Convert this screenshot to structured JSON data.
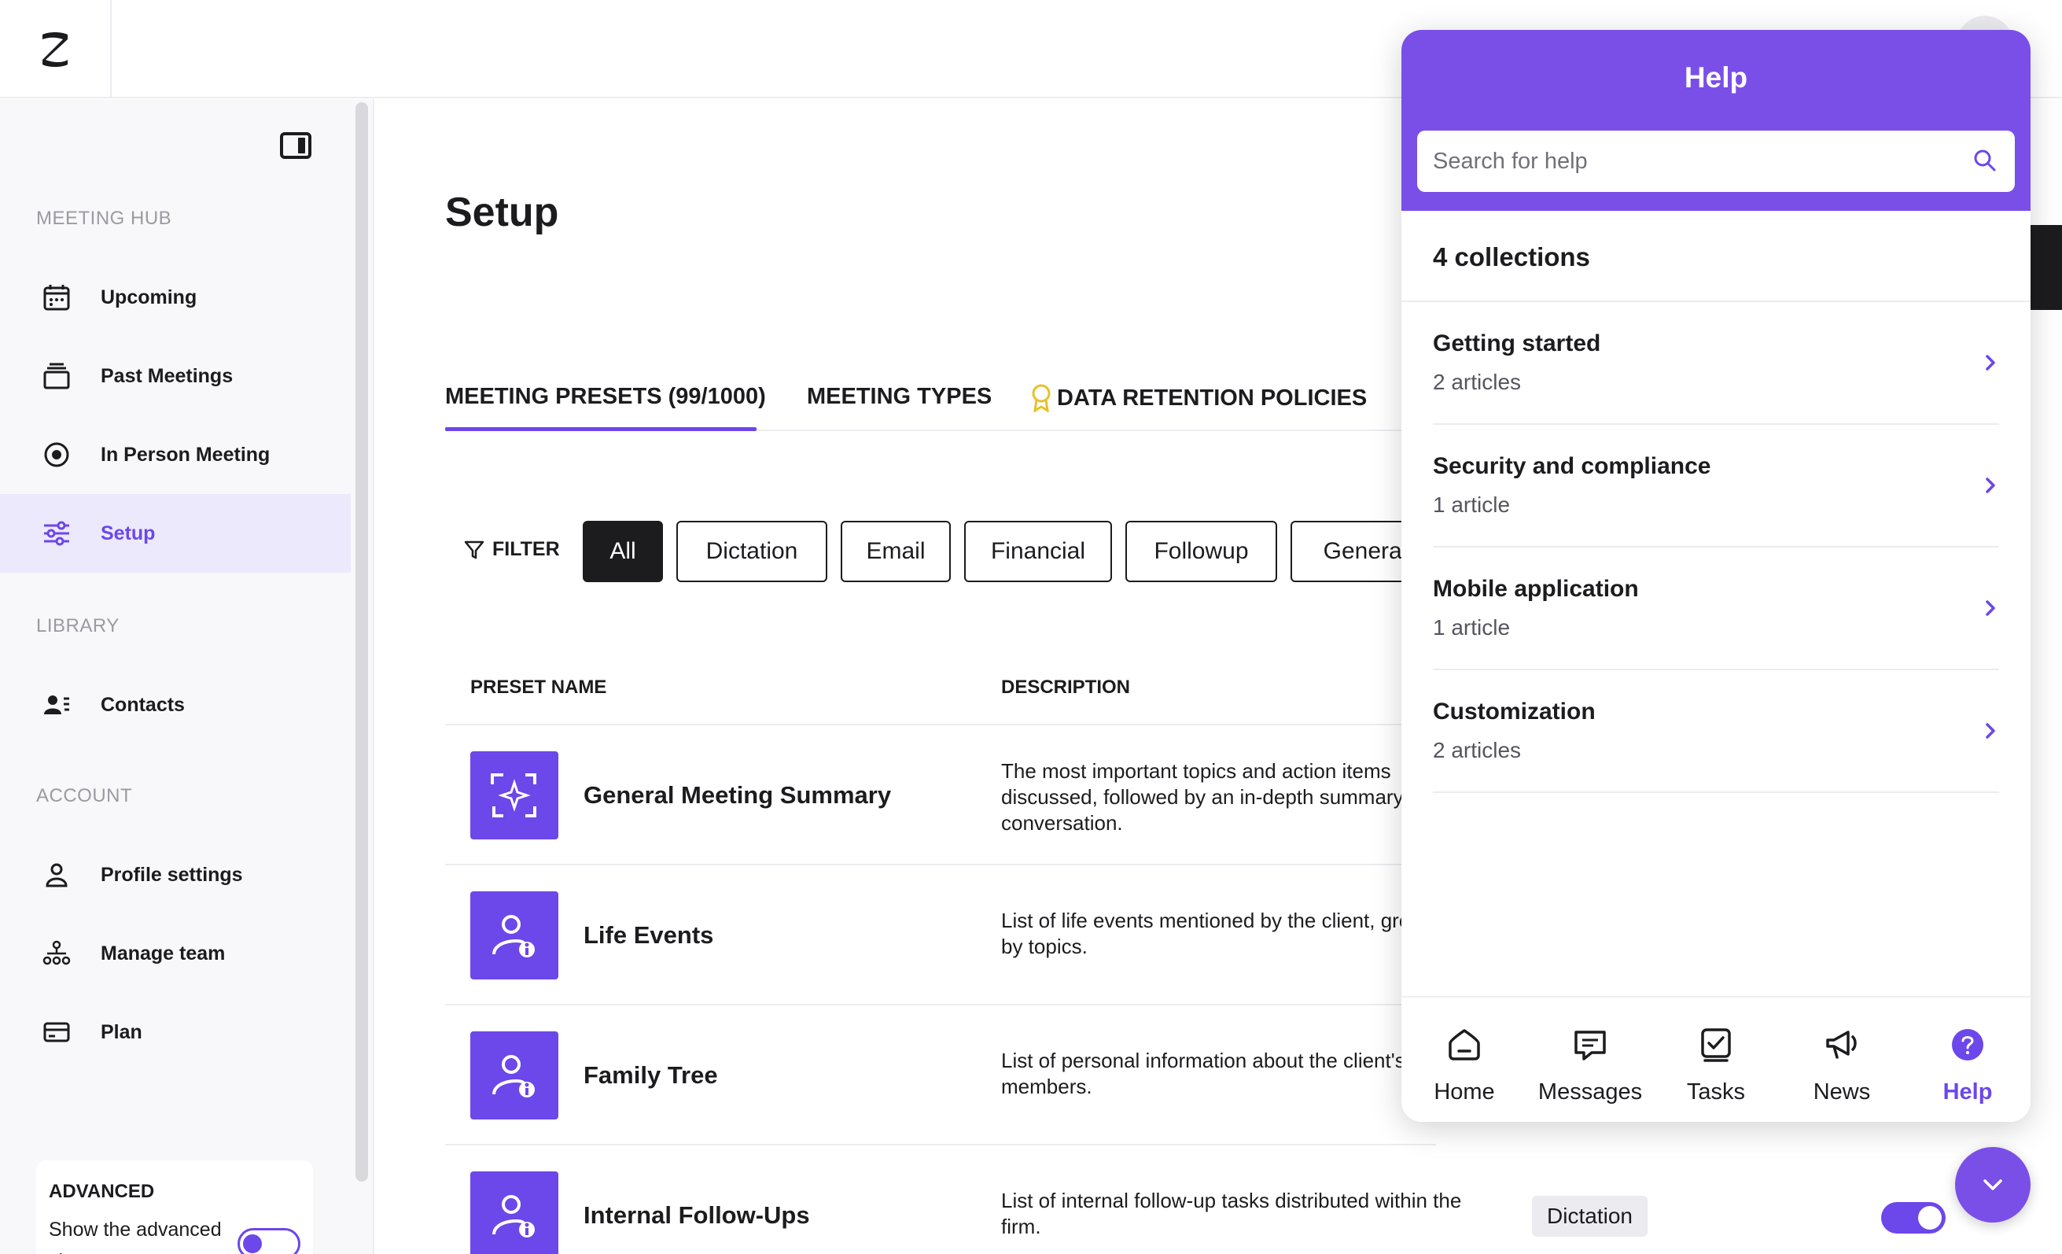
{
  "sidebar": {
    "sections": {
      "meeting_hub": "MEETING HUB",
      "library": "LIBRARY",
      "account": "ACCOUNT"
    },
    "items": [
      {
        "label": "Upcoming",
        "icon": "calendar-icon"
      },
      {
        "label": "Past Meetings",
        "icon": "stack-icon"
      },
      {
        "label": "In Person Meeting",
        "icon": "record-icon"
      },
      {
        "label": "Setup",
        "icon": "sliders-icon",
        "active": true
      },
      {
        "label": "Contacts",
        "icon": "contacts-icon"
      },
      {
        "label": "Profile settings",
        "icon": "user-icon"
      },
      {
        "label": "Manage team",
        "icon": "team-icon"
      },
      {
        "label": "Plan",
        "icon": "card-icon"
      }
    ],
    "advanced": {
      "title": "ADVANCED",
      "text": "Show the advanced view",
      "toggle_on": true
    }
  },
  "main": {
    "title": "Setup",
    "tabs": [
      {
        "label": "MEETING PRESETS (99/1000)",
        "active": true
      },
      {
        "label": "MEETING TYPES"
      },
      {
        "label": "DATA RETENTION POLICIES",
        "icon": "award-icon"
      }
    ],
    "filter_label": "FILTER",
    "chips": [
      "All",
      "Dictation",
      "Email",
      "Financial",
      "Followup",
      "General"
    ],
    "active_chip": "All",
    "table": {
      "headers": {
        "name": "PRESET NAME",
        "description": "DESCRIPTION"
      },
      "rows": [
        {
          "name": "General Meeting Summary",
          "description": "The most important topics and action items discussed, followed by an in-depth summary of the conversation.",
          "icon": "sparkle-frame-icon"
        },
        {
          "name": "Life Events",
          "description": "List of life events mentioned by the client, grouped by topics.",
          "icon": "user-info-icon"
        },
        {
          "name": "Family Tree",
          "description": "List of personal information about the client's family members.",
          "icon": "user-info-icon"
        },
        {
          "name": "Internal Follow-Ups",
          "description": "List of internal follow-up tasks distributed within the firm.",
          "icon": "user-info-icon",
          "badge": "Dictation",
          "enabled": true
        }
      ]
    }
  },
  "help": {
    "title": "Help",
    "search_placeholder": "Search for help",
    "collections_count": "4 collections",
    "collections": [
      {
        "title": "Getting started",
        "subtitle": "2 articles"
      },
      {
        "title": "Security and compliance",
        "subtitle": "1 article"
      },
      {
        "title": "Mobile application",
        "subtitle": "1 article"
      },
      {
        "title": "Customization",
        "subtitle": "2 articles"
      }
    ],
    "footer_tabs": [
      {
        "label": "Home",
        "icon": "home-icon"
      },
      {
        "label": "Messages",
        "icon": "message-icon"
      },
      {
        "label": "Tasks",
        "icon": "tasks-icon"
      },
      {
        "label": "News",
        "icon": "megaphone-icon"
      },
      {
        "label": "Help",
        "icon": "question-icon",
        "active": true
      }
    ]
  },
  "colors": {
    "accent": "#6c47ea",
    "help_header": "#7a4fe8",
    "active_nav_bg": "#ece9fd",
    "text": "#1c1c1f",
    "muted": "#9a9aa2"
  }
}
